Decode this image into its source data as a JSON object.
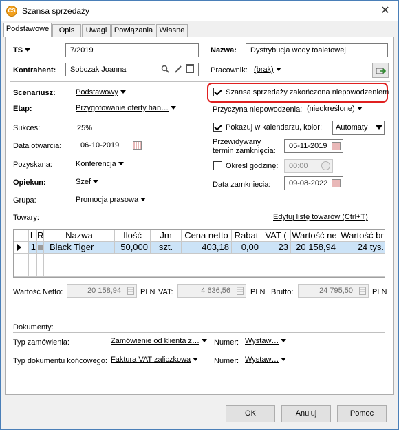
{
  "window": {
    "title": "Szansa sprzedaży"
  },
  "tabs": [
    "Podstawowe",
    "Opis",
    "Uwagi",
    "Powiązania",
    "Własne"
  ],
  "form": {
    "ts_label": "TS",
    "ts_value": "7/2019",
    "nazwa_label": "Nazwa:",
    "nazwa_value": "Dystrybucja wody toaletowej",
    "kontrahent_label": "Kontrahent:",
    "kontrahent_value": "Sobczak Joanna",
    "pracownik_label": "Pracownik:",
    "pracownik_value": "(brak)",
    "scenariusz_label": "Scenariusz:",
    "scenariusz_value": "Podstawowy",
    "etap_label": "Etap:",
    "etap_value": "Przygotowanie oferty han…",
    "sukces_label": "Sukces:",
    "sukces_value": "25%",
    "data_otwarcia_label": "Data otwarcia:",
    "data_otwarcia_value": "06-10-2019",
    "pozyskana_label": "Pozyskana:",
    "pozyskana_value": "Konferencja",
    "opiekun_label": "Opiekun:",
    "opiekun_value": "Szef",
    "grupa_label": "Grupa:",
    "grupa_value": "Promocja prasowa",
    "zakonczona_label": "Szansa sprzedaży zakończona niepowodzeniem",
    "zakonczona_checked": true,
    "przyczyna_label": "Przyczyna niepowodzenia:",
    "przyczyna_value": "(nieokreślone)",
    "kalendarz_label": "Pokazuj w kalendarzu, kolor:",
    "kalendarz_checked": true,
    "kolor_value": "Automaty",
    "przewidywany_label_1": "Przewidywany",
    "przewidywany_label_2": "termin zamknięcia:",
    "przewidywany_value": "05-11-2019",
    "godzina_label": "Określ godzinę:",
    "godzina_checked": false,
    "godzina_value": "00:00",
    "data_zamkniecia_label": "Data zamkniecia:",
    "data_zamkniecia_value": "09-08-2022"
  },
  "towary": {
    "label": "Towary:",
    "edit_link": "Edytuj listę towarów  (Ctrl+T)",
    "columns": [
      "L",
      "R",
      "Nazwa",
      "Ilość",
      "Jm",
      "Cena netto",
      "Rabat",
      "VAT (",
      "Wartość ne",
      "Wartość br"
    ],
    "rows": [
      {
        "l": "1",
        "r": "",
        "nazwa": "Black Tiger",
        "ilosc": "50,000",
        "jm": "szt.",
        "cena": "403,18",
        "rabat": "0,00",
        "vat": "23",
        "netto": "20 158,94",
        "brutto": "24 tys."
      }
    ]
  },
  "totals": {
    "netto_label": "Wartość Netto:",
    "netto_value": "20 158,94",
    "vat_label": "VAT:",
    "vat_value": "4 636,56",
    "brutto_label": "Brutto:",
    "brutto_value": "24 795,50",
    "currency": "PLN"
  },
  "dokumenty": {
    "label": "Dokumenty:",
    "typ_zam_label": "Typ zamówienia:",
    "typ_zam_value": "Zamówienie od klienta z…",
    "numer_label": "Numer:",
    "numer1_value": "Wystaw…",
    "typ_dok_label": "Typ dokumentu końcowego:",
    "typ_dok_value": "Faktura VAT zaliczkowa",
    "numer2_value": "Wystaw…"
  },
  "buttons": {
    "ok": "OK",
    "cancel": "Anuluj",
    "help": "Pomoc"
  },
  "colors": {
    "highlight_border": "#e02020",
    "selection": "#cce3f7",
    "title_icon": "#f2a01e"
  }
}
